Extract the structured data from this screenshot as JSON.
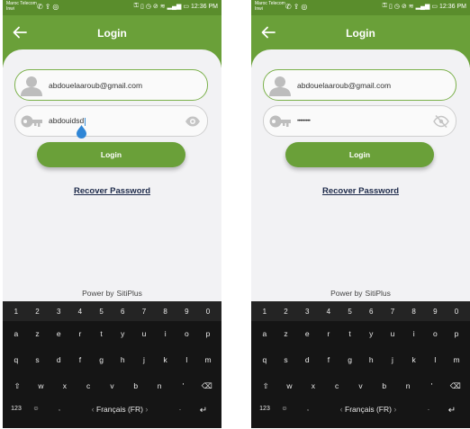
{
  "screens": [
    {
      "status": {
        "carrier_line1": "Maroc Telecom",
        "carrier_line2": "Inwi",
        "time": "12:36 PM",
        "battery": "▭"
      },
      "header": {
        "title": "Login"
      },
      "email": {
        "value": "abdouelaaroub@gmail.com"
      },
      "password": {
        "value": "abdouidsd"
      },
      "login_button": "Login",
      "recover_link": "Recover Password",
      "footer": {
        "prefix": "Power by",
        "brand": "SitiPlus"
      }
    },
    {
      "status": {
        "carrier_line1": "Maroc Telecom",
        "carrier_line2": "Inwi",
        "time": "12:36 PM",
        "battery": "▭"
      },
      "header": {
        "title": "Login"
      },
      "email": {
        "value": "abdouelaaroub@gmail.com"
      },
      "password": {
        "value": "•••••••••"
      },
      "login_button": "Login",
      "recover_link": "Recover Password",
      "footer": {
        "prefix": "Power by",
        "brand": "SitiPlus"
      }
    }
  ],
  "keyboard": {
    "numbers": [
      "1",
      "2",
      "3",
      "4",
      "5",
      "6",
      "7",
      "8",
      "9",
      "0"
    ],
    "row1": [
      "a",
      "z",
      "e",
      "r",
      "t",
      "y",
      "u",
      "i",
      "o",
      "p"
    ],
    "row2": [
      "q",
      "s",
      "d",
      "f",
      "g",
      "h",
      "j",
      "k",
      "l",
      "m"
    ],
    "row3": [
      "w",
      "x",
      "c",
      "v",
      "b",
      "n",
      "'"
    ],
    "symbols_key": "123",
    "language": "Français (FR)"
  },
  "colors": {
    "header": "#6aa039",
    "status_bar": "#5a8d2c",
    "keyboard": "#151515",
    "link": "#1d2a4a"
  }
}
